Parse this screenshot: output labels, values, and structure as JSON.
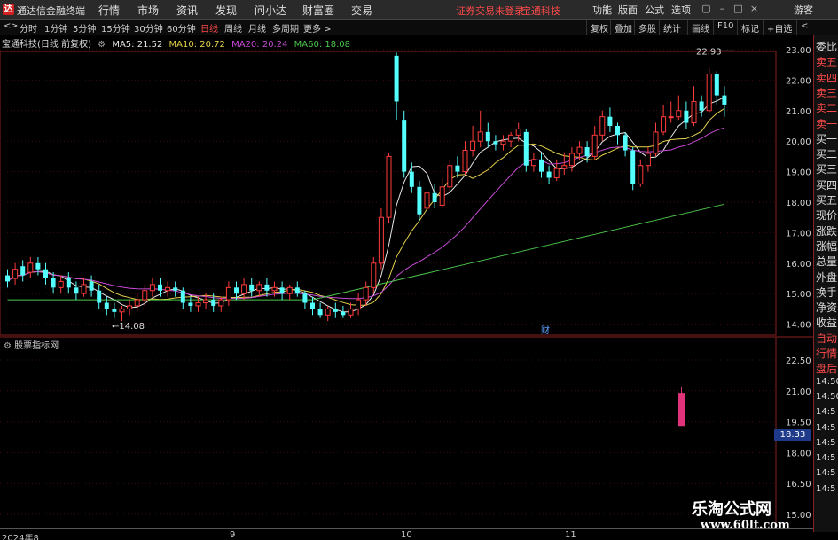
{
  "topbar": {
    "logo_text": "达",
    "app_title": "通达信金融终端",
    "menus": [
      "行情",
      "市场",
      "资讯",
      "发现",
      "问小达",
      "财富圈",
      "交易"
    ],
    "status_login": "证券交易未登录",
    "status_stock": "宝通科技",
    "tools": [
      "功能",
      "版面",
      "公式",
      "选项"
    ],
    "user": "游客",
    "win_ctrls": [
      "▢",
      "–",
      "□",
      "×"
    ]
  },
  "periodbar": {
    "periods": [
      "分时",
      "1分钟",
      "5分钟",
      "15分钟",
      "30分钟",
      "60分钟",
      "日线",
      "周线",
      "月线",
      "多周期",
      "更多 >"
    ],
    "active_period": "日线",
    "right_tools": [
      "复权",
      "叠加",
      "多股",
      "统计",
      "画线",
      "F10",
      "标记",
      "+自选"
    ],
    "nav_icons": [
      "<",
      ">",
      "<"
    ]
  },
  "ma_legend": {
    "stock": "宝通科技(日线 前复权)",
    "ma5": "MA5: 21.52",
    "ma10": "MA10: 20.72",
    "ma20": "MA20: 20.24",
    "ma60": "MA60: 18.08"
  },
  "colors": {
    "up": "#ff3b3b",
    "down": "#54ffff",
    "ma5": "#e8e8e8",
    "ma10": "#e6d24a",
    "ma20": "#c84bd6",
    "ma60": "#4bc84b",
    "grid": "#8a1f1f"
  },
  "main_axis": {
    "ticks": [
      "23.00",
      "22.00",
      "21.00",
      "20.00",
      "19.00",
      "18.00",
      "17.00",
      "16.00",
      "15.00",
      "14.00"
    ],
    "high_label": "22.93",
    "low_label": "14.08",
    "fin_marker": "财"
  },
  "indicator": {
    "title": "股票指标网",
    "ticks": [
      "22.50",
      "21.00",
      "19.50",
      "18.00",
      "16.50",
      "15.00"
    ],
    "price_tag": "18.33"
  },
  "right_panel": {
    "items": [
      "委比",
      "卖五",
      "卖四",
      "卖三",
      "卖二",
      "卖一",
      "买一",
      "买二",
      "买三",
      "买四",
      "买五",
      "现价",
      "涨跌",
      "涨幅",
      "总量",
      "外盘",
      "换手",
      "净资",
      "收益",
      "自动",
      "行情",
      "盘后",
      "14:50",
      "14:50",
      "14:5",
      "14:5",
      "14:5",
      "14:5",
      "14:5",
      "14:5"
    ]
  },
  "dates": [
    "2024年8",
    "9",
    "10",
    "11"
  ],
  "watermark": {
    "line1": "乐淘公式网",
    "line2": "www.60lt.com"
  }
}
